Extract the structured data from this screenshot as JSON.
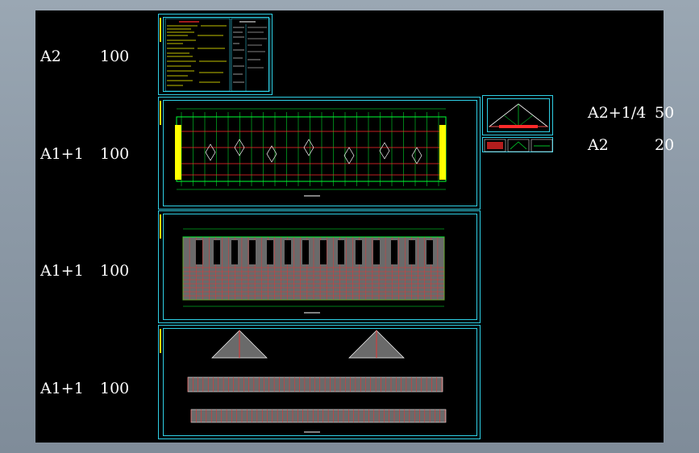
{
  "rows": [
    {
      "size": "A2",
      "scale": "100"
    },
    {
      "size": "A1+1",
      "scale": "100"
    },
    {
      "size": "A1+1",
      "scale": "100"
    },
    {
      "size": "A1+1",
      "scale": "100"
    }
  ],
  "side_labels": [
    {
      "size": "A2+1/4",
      "scale": "50"
    },
    {
      "size": "A2",
      "scale": "20"
    }
  ],
  "colors": {
    "frame": "#2fd0e6",
    "green": "#00ff33",
    "red": "#ff2a2a",
    "yellow": "#ffff00",
    "white": "#ffffff"
  }
}
